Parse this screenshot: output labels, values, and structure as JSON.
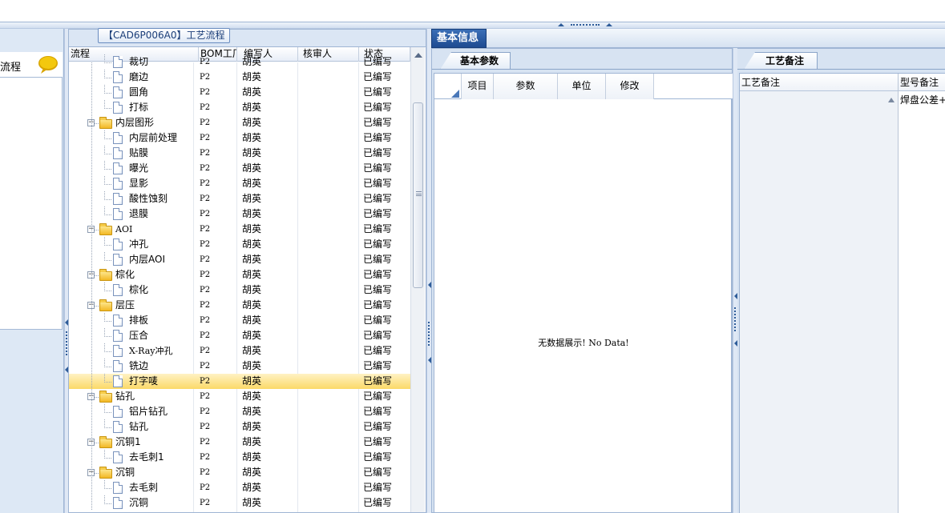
{
  "tree_panel": {
    "title": "【CAD6P006A0】工艺流程",
    "columns": [
      "流程",
      "BOM工厂",
      "编写人",
      "核审人",
      "状态"
    ]
  },
  "left_panel": {
    "label": "流程",
    "icon": "speech-bubble-icon"
  },
  "tree_rows": [
    {
      "name": "裁切",
      "level": 2,
      "type": "doc",
      "bom": "P2",
      "writer": "胡英",
      "reviewer": "",
      "status": "已编写"
    },
    {
      "name": "磨边",
      "level": 2,
      "type": "doc",
      "bom": "P2",
      "writer": "胡英",
      "reviewer": "",
      "status": "已编写"
    },
    {
      "name": "圆角",
      "level": 2,
      "type": "doc",
      "bom": "P2",
      "writer": "胡英",
      "reviewer": "",
      "status": "已编写"
    },
    {
      "name": "打标",
      "level": 2,
      "type": "doc",
      "bom": "P2",
      "writer": "胡英",
      "reviewer": "",
      "status": "已编写"
    },
    {
      "name": "内层图形",
      "level": 1,
      "type": "folder",
      "bom": "P2",
      "writer": "胡英",
      "reviewer": "",
      "status": "已编写"
    },
    {
      "name": "内层前处理",
      "level": 2,
      "type": "doc",
      "bom": "P2",
      "writer": "胡英",
      "reviewer": "",
      "status": "已编写"
    },
    {
      "name": "贴膜",
      "level": 2,
      "type": "doc",
      "bom": "P2",
      "writer": "胡英",
      "reviewer": "",
      "status": "已编写"
    },
    {
      "name": "曝光",
      "level": 2,
      "type": "doc",
      "bom": "P2",
      "writer": "胡英",
      "reviewer": "",
      "status": "已编写"
    },
    {
      "name": "显影",
      "level": 2,
      "type": "doc",
      "bom": "P2",
      "writer": "胡英",
      "reviewer": "",
      "status": "已编写"
    },
    {
      "name": "酸性蚀刻",
      "level": 2,
      "type": "doc",
      "bom": "P2",
      "writer": "胡英",
      "reviewer": "",
      "status": "已编写"
    },
    {
      "name": "退膜",
      "level": 2,
      "type": "doc",
      "bom": "P2",
      "writer": "胡英",
      "reviewer": "",
      "status": "已编写"
    },
    {
      "name": "AOI",
      "level": 1,
      "type": "folder",
      "bom": "P2",
      "writer": "胡英",
      "reviewer": "",
      "status": "已编写"
    },
    {
      "name": "冲孔",
      "level": 2,
      "type": "doc",
      "bom": "P2",
      "writer": "胡英",
      "reviewer": "",
      "status": "已编写"
    },
    {
      "name": "内层AOI",
      "level": 2,
      "type": "doc",
      "bom": "P2",
      "writer": "胡英",
      "reviewer": "",
      "status": "已编写"
    },
    {
      "name": "棕化",
      "level": 1,
      "type": "folder",
      "bom": "P2",
      "writer": "胡英",
      "reviewer": "",
      "status": "已编写"
    },
    {
      "name": "棕化",
      "level": 2,
      "type": "doc",
      "bom": "P2",
      "writer": "胡英",
      "reviewer": "",
      "status": "已编写"
    },
    {
      "name": "层压",
      "level": 1,
      "type": "folder",
      "bom": "P2",
      "writer": "胡英",
      "reviewer": "",
      "status": "已编写"
    },
    {
      "name": "排板",
      "level": 2,
      "type": "doc",
      "bom": "P2",
      "writer": "胡英",
      "reviewer": "",
      "status": "已编写"
    },
    {
      "name": "压合",
      "level": 2,
      "type": "doc",
      "bom": "P2",
      "writer": "胡英",
      "reviewer": "",
      "status": "已编写"
    },
    {
      "name": "X-Ray冲孔",
      "level": 2,
      "type": "doc",
      "bom": "P2",
      "writer": "胡英",
      "reviewer": "",
      "status": "已编写"
    },
    {
      "name": "铣边",
      "level": 2,
      "type": "doc",
      "bom": "P2",
      "writer": "胡英",
      "reviewer": "",
      "status": "已编写"
    },
    {
      "name": "打字唛",
      "level": 2,
      "type": "doc",
      "bom": "P2",
      "writer": "胡英",
      "reviewer": "",
      "status": "已编写",
      "selected": true
    },
    {
      "name": "钻孔",
      "level": 1,
      "type": "folder",
      "bom": "P2",
      "writer": "胡英",
      "reviewer": "",
      "status": "已编写"
    },
    {
      "name": "铝片钻孔",
      "level": 2,
      "type": "doc",
      "bom": "P2",
      "writer": "胡英",
      "reviewer": "",
      "status": "已编写"
    },
    {
      "name": "钻孔",
      "level": 2,
      "type": "doc",
      "bom": "P2",
      "writer": "胡英",
      "reviewer": "",
      "status": "已编写"
    },
    {
      "name": "沉铜1",
      "level": 1,
      "type": "folder",
      "bom": "P2",
      "writer": "胡英",
      "reviewer": "",
      "status": "已编写"
    },
    {
      "name": "去毛刺1",
      "level": 2,
      "type": "doc",
      "bom": "P2",
      "writer": "胡英",
      "reviewer": "",
      "status": "已编写"
    },
    {
      "name": "沉铜",
      "level": 1,
      "type": "folder",
      "bom": "P2",
      "writer": "胡英",
      "reviewer": "",
      "status": "已编写"
    },
    {
      "name": "去毛刺",
      "level": 2,
      "type": "doc",
      "bom": "P2",
      "writer": "胡英",
      "reviewer": "",
      "status": "已编写"
    },
    {
      "name": "沉铜",
      "level": 2,
      "type": "doc",
      "bom": "P2",
      "writer": "胡英",
      "reviewer": "",
      "status": "已编写"
    }
  ],
  "middle_panel": {
    "main_tab": "基本信息",
    "sub_tab": "基本参数",
    "columns": [
      "项目",
      "参数",
      "单位",
      "修改"
    ],
    "empty_message": "无数据展示! No Data!"
  },
  "right_panel": {
    "tab": "工艺备注",
    "columns": [
      "工艺备注",
      "型号备注"
    ],
    "value": "焊盘公差+/"
  },
  "colors": {
    "selected_row": "#fbd968",
    "main_tab_bg": "#1e4b91",
    "panel_bg": "#d7e3f2",
    "folder": "#f2b824"
  }
}
